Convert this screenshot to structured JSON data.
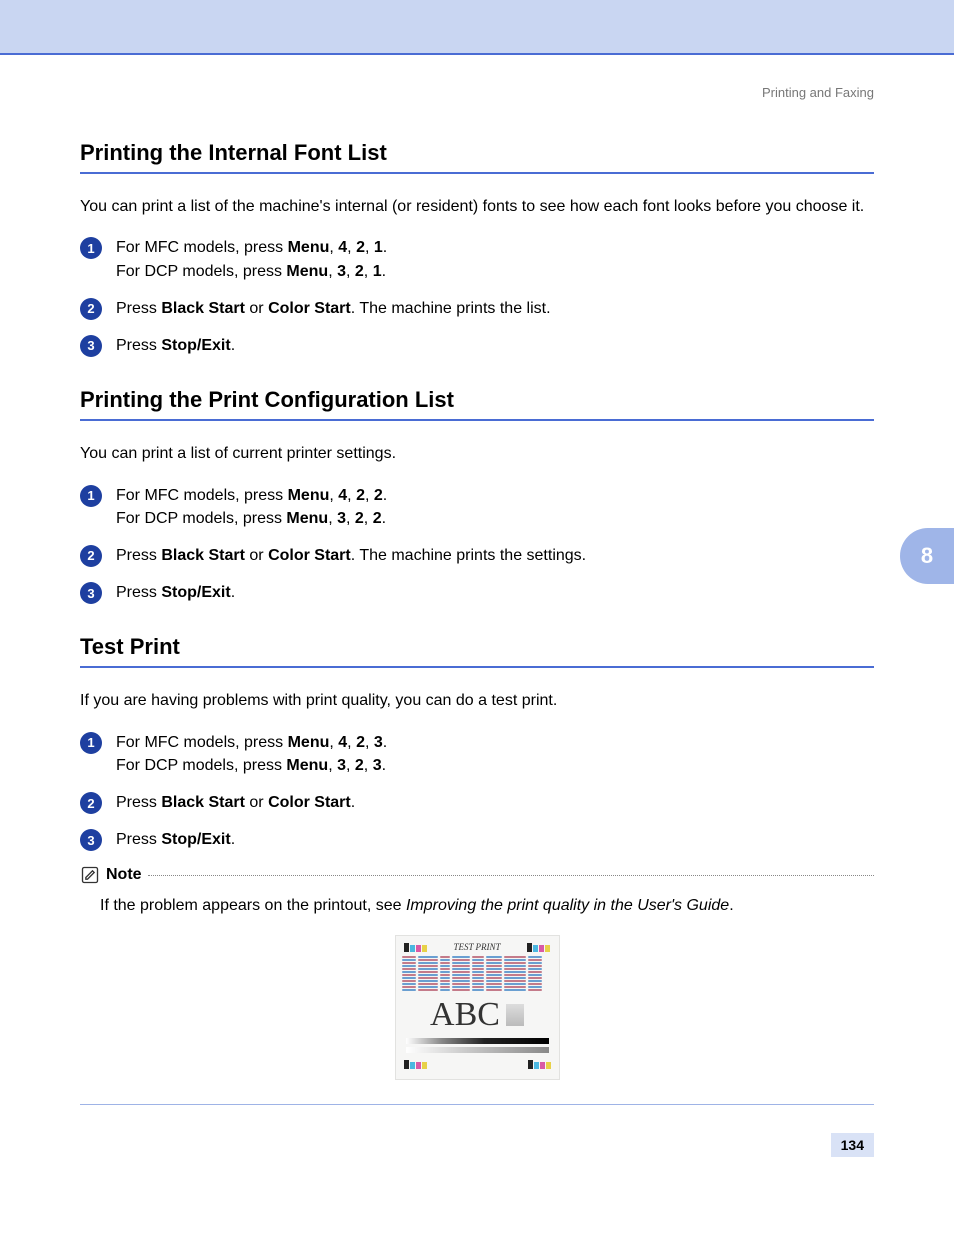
{
  "breadcrumb": "Printing and Faxing",
  "chapter": "8",
  "page_number": "134",
  "sections": {
    "s1": {
      "title": "Printing the Internal Font List",
      "intro": "You can print a list of the machine's internal (or resident) fonts to see how each font looks before you choose it.",
      "step1_pre": "For MFC models, press ",
      "menu": "Menu",
      "s1_seq_mfc_1": "4",
      "s1_seq_mfc_2": "2",
      "s1_seq_mfc_3": "1",
      "step1_line2_pre": "For DCP models, press ",
      "s1_seq_dcp_1": "3",
      "s1_seq_dcp_2": "2",
      "s1_seq_dcp_3": "1",
      "step2_pre": "Press ",
      "black_start": "Black Start",
      "or": " or ",
      "color_start": "Color Start",
      "step2_post": ". The machine prints the list.",
      "step3_pre": "Press ",
      "stop_exit": "Stop/Exit",
      "period": "."
    },
    "s2": {
      "title": "Printing the Print Configuration List",
      "intro": "You can print a list of current printer settings.",
      "s2_seq_mfc_1": "4",
      "s2_seq_mfc_2": "2",
      "s2_seq_mfc_3": "2",
      "s2_seq_dcp_1": "3",
      "s2_seq_dcp_2": "2",
      "s2_seq_dcp_3": "2",
      "step2_post": ". The machine prints the settings."
    },
    "s3": {
      "title": "Test Print",
      "intro": "If you are having problems with print quality, you can do a test print.",
      "s3_seq_mfc_1": "4",
      "s3_seq_mfc_2": "2",
      "s3_seq_mfc_3": "3",
      "s3_seq_dcp_1": "3",
      "s3_seq_dcp_2": "2",
      "s3_seq_dcp_3": "3"
    }
  },
  "note": {
    "label": "Note",
    "body_pre": "If the problem appears on the printout, see ",
    "body_em": "Improving the print quality in the User's Guide",
    "body_post": "."
  },
  "testprint": {
    "title": "TEST PRINT",
    "abc": "ABC"
  },
  "comma_sep": ", "
}
